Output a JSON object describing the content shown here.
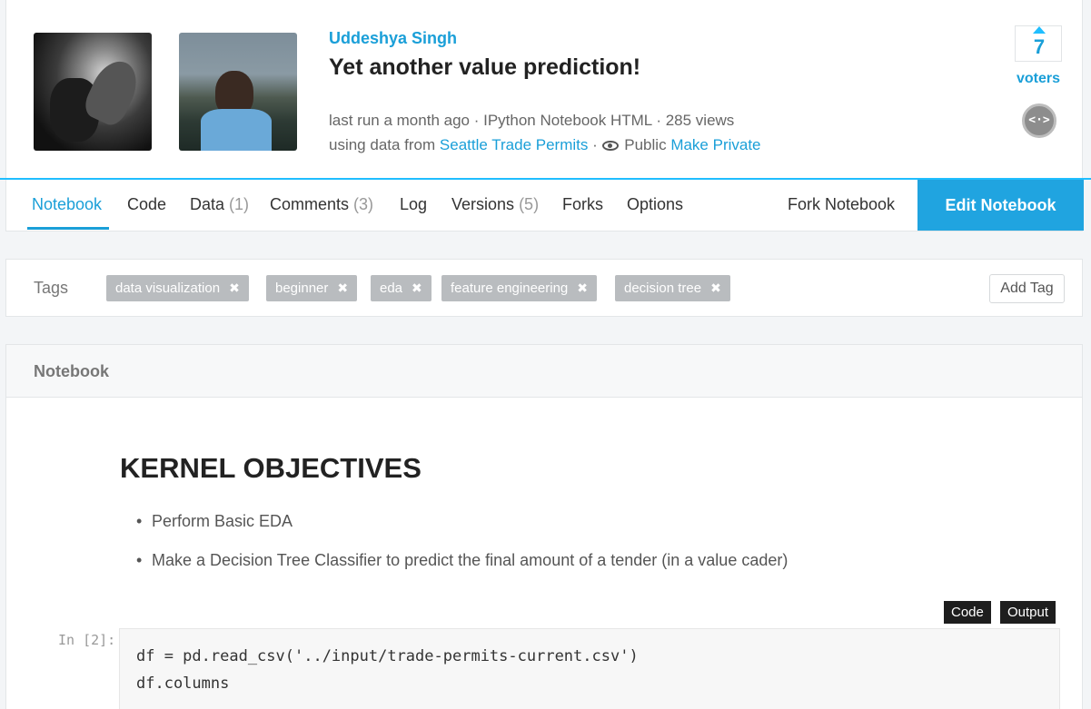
{
  "header": {
    "author": "Uddeshya Singh",
    "title": "Yet another value prediction!",
    "meta_line1": "last run a month ago · IPython Notebook HTML · 285 views",
    "meta_using": "using data from",
    "dataset_link": "Seattle Trade Permits",
    "visibility_sep": "·",
    "visibility": "Public",
    "make_private": "Make Private",
    "vote_count": "7",
    "voters_label": "voters",
    "code_icon_text": "<·>"
  },
  "tabs": [
    {
      "label": "Notebook",
      "count": "",
      "active": true
    },
    {
      "label": "Code",
      "count": ""
    },
    {
      "label": "Data",
      "count": "(1)"
    },
    {
      "label": "Comments",
      "count": "(3)"
    },
    {
      "label": "Log",
      "count": ""
    },
    {
      "label": "Versions",
      "count": "(5)"
    },
    {
      "label": "Forks",
      "count": ""
    },
    {
      "label": "Options",
      "count": ""
    }
  ],
  "actions": {
    "fork": "Fork Notebook",
    "edit": "Edit Notebook"
  },
  "tags": {
    "label": "Tags",
    "items": [
      "data visualization",
      "beginner",
      "eda",
      "feature engineering",
      "decision tree"
    ],
    "remove_glyph": "✖",
    "add_label": "Add Tag"
  },
  "notebook": {
    "header": "Notebook",
    "heading": "KERNEL OBJECTIVES",
    "bullets": [
      "Perform Basic EDA",
      "Make a Decision Tree Classifier to predict the final amount of a tender (in a value cader)"
    ],
    "code_btn": "Code",
    "output_btn": "Output",
    "prompt": "In [2]:",
    "code_lines": [
      "df = pd.read_csv('../input/trade-permits-current.csv')",
      "df.columns"
    ]
  }
}
